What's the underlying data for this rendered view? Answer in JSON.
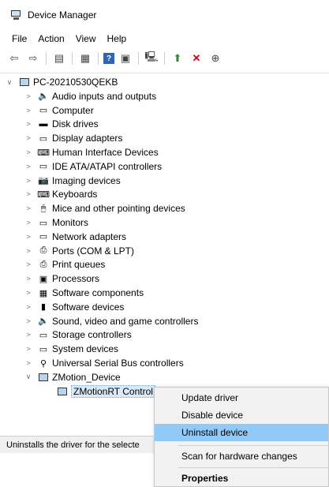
{
  "window": {
    "title": "Device Manager"
  },
  "menu": [
    "File",
    "Action",
    "View",
    "Help"
  ],
  "toolbar": [
    {
      "name": "back-icon",
      "glyph": "⇦"
    },
    {
      "name": "forward-icon",
      "glyph": "⇨"
    },
    {
      "name": "sep"
    },
    {
      "name": "show-hide-console-tree-icon",
      "glyph": "▤"
    },
    {
      "name": "sep"
    },
    {
      "name": "properties-icon",
      "glyph": "▦"
    },
    {
      "name": "sep"
    },
    {
      "name": "help-icon",
      "glyph": "?"
    },
    {
      "name": "view-resources-icon",
      "glyph": "▣"
    },
    {
      "name": "sep"
    },
    {
      "name": "scan-hardware-icon",
      "glyph": "🖳"
    },
    {
      "name": "sep"
    },
    {
      "name": "update-driver-icon",
      "glyph": "⬆"
    },
    {
      "name": "uninstall-icon",
      "glyph": "✕"
    },
    {
      "name": "download-icon",
      "glyph": "⊕"
    }
  ],
  "tree": {
    "root": "PC-20210530QEKB",
    "categories": [
      "Audio inputs and outputs",
      "Computer",
      "Disk drives",
      "Display adapters",
      "Human Interface Devices",
      "IDE ATA/ATAPI controllers",
      "Imaging devices",
      "Keyboards",
      "Mice and other pointing devices",
      "Monitors",
      "Network adapters",
      "Ports (COM & LPT)",
      "Print queues",
      "Processors",
      "Software components",
      "Software devices",
      "Sound, video and game controllers",
      "Storage controllers",
      "System devices",
      "Universal Serial Bus controllers"
    ],
    "expanded_category": "ZMotion_Device",
    "selected_device": "ZMotionRT Control"
  },
  "status": "Uninstalls the driver for the selecte",
  "context_menu": {
    "items": [
      "Update driver",
      "Disable device",
      "Uninstall device"
    ],
    "scan": "Scan for hardware changes",
    "properties": "Properties",
    "highlight_color": "#91c9f7"
  }
}
